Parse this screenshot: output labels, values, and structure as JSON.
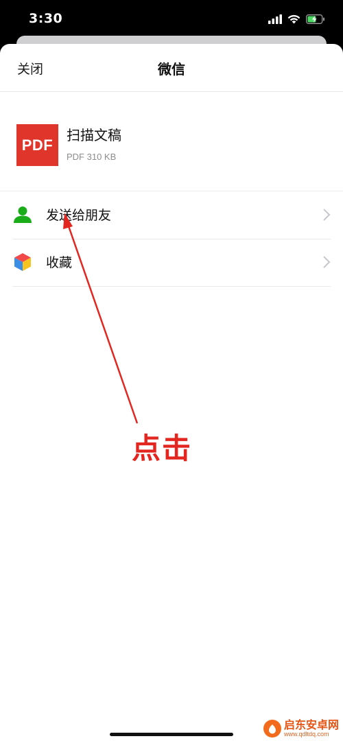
{
  "status_bar": {
    "time": "3:30",
    "icons": [
      "signal-icon",
      "wifi-icon",
      "battery-charging-icon"
    ]
  },
  "nav": {
    "close_label": "关闭",
    "title": "微信"
  },
  "file": {
    "icon_label": "PDF",
    "name": "扫描文稿",
    "meta": "PDF 310 KB"
  },
  "menu": {
    "items": [
      {
        "label": "发送给朋友",
        "icon": "person-icon"
      },
      {
        "label": "收藏",
        "icon": "favorites-cube-icon"
      }
    ]
  },
  "annotation": {
    "text": "点击",
    "color": "#e3261f"
  },
  "watermark": {
    "cn": "启东安卓网",
    "url": "www.qdltdq.com"
  },
  "colors": {
    "pdf_red": "#e0352b",
    "person_green": "#1aad19"
  }
}
